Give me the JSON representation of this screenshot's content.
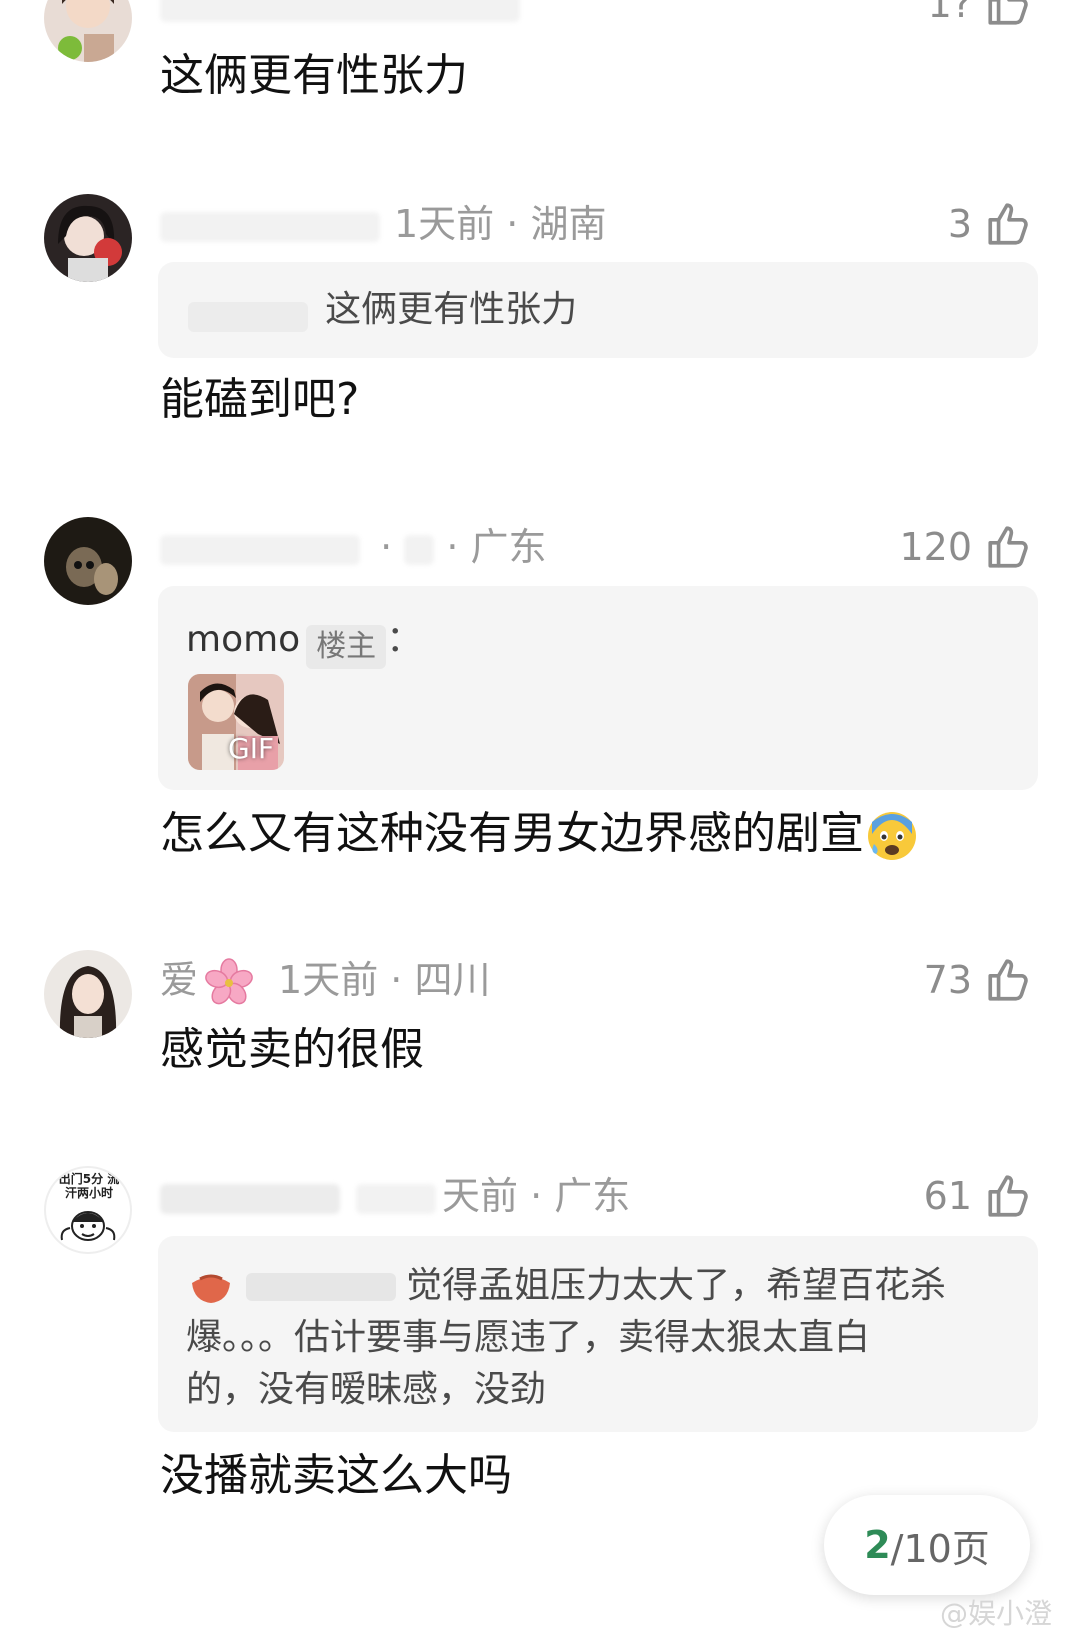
{
  "comments": [
    {
      "meta_time": "",
      "meta_loc": "",
      "likes": "",
      "content": "这俩更有性张力"
    },
    {
      "meta_time": "1天前",
      "meta_loc": "湖南",
      "likes": "3",
      "quote": "这俩更有性张力",
      "content": "能磕到吧?"
    },
    {
      "meta_loc": "广东",
      "likes": "120",
      "quote_user": "momo",
      "quote_tag": "楼主",
      "quote_colon": "：",
      "gif_label": "GIF",
      "content": "怎么又有这种没有男女边界感的剧宣"
    },
    {
      "name": "爱",
      "meta_time": "1天前",
      "meta_loc": "四川",
      "likes": "73",
      "content": "感觉卖的很假"
    },
    {
      "meta_time": "天前",
      "meta_loc": "广东",
      "likes": "61",
      "quote_line1": "觉得孟姐压力太大了，希望百花杀",
      "quote_line2": "爆。。。估计要事与愿违了，卖得太狠太直白",
      "quote_line3": "的，没有暧昧感，没劲",
      "avatar_text": "出门5分 流汗两小时",
      "content": "没播就卖这么大吗"
    }
  ],
  "pagination": {
    "current": "2",
    "total": "/10页"
  },
  "watermark": "@娱小澄",
  "colors": {
    "page_current": "#2e8b57",
    "meta": "#9a9a9a",
    "quote_bg": "#f5f5f5"
  }
}
